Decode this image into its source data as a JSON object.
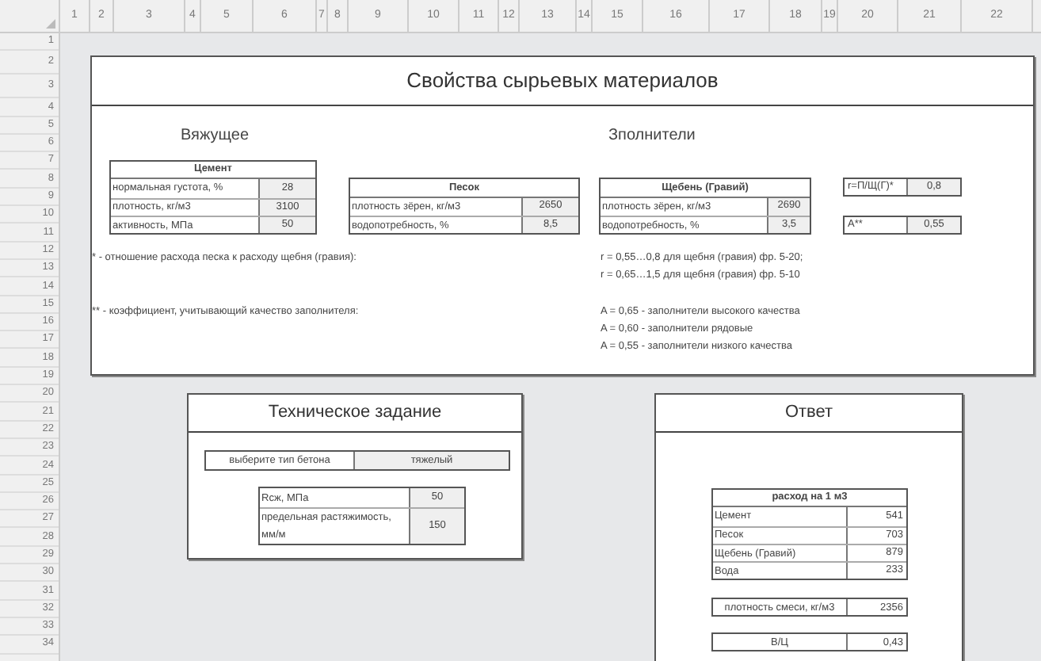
{
  "sheet": {
    "columns": [
      "1",
      "2",
      "3",
      "4",
      "5",
      "6",
      "7",
      "8",
      "9",
      "10",
      "11",
      "12",
      "13",
      "14",
      "15",
      "16",
      "17",
      "18",
      "19",
      "20",
      "21",
      "22"
    ],
    "rows": [
      "1",
      "2",
      "3",
      "4",
      "5",
      "6",
      "7",
      "8",
      "9",
      "10",
      "11",
      "12",
      "13",
      "14",
      "15",
      "16",
      "17",
      "18",
      "19",
      "20",
      "21",
      "22",
      "23",
      "24",
      "25",
      "26",
      "27",
      "28",
      "29",
      "30",
      "31",
      "32",
      "33",
      "34"
    ]
  },
  "properties": {
    "title": "Свойства сырьевых материалов",
    "binder": {
      "heading": "Вяжущее",
      "table": {
        "title": "Цемент",
        "rows": [
          {
            "label": "нормальная густота, %",
            "value": "28"
          },
          {
            "label": "плотность, кг/м3",
            "value": "3100"
          },
          {
            "label": "активность, МПа",
            "value": "50"
          }
        ]
      }
    },
    "aggregates": {
      "heading": "Зполнители",
      "sand": {
        "title": "Песок",
        "rows": [
          {
            "label": "плотность зёрен, кг/м3",
            "value": "2650"
          },
          {
            "label": "водопотребность, %",
            "value": "8,5"
          }
        ]
      },
      "gravel": {
        "title": "Щебень (Гравий)",
        "rows": [
          {
            "label": "плотность зёрен, кг/м3",
            "value": "2690"
          },
          {
            "label": "водопотребность, %",
            "value": "3,5"
          }
        ]
      },
      "ratio": {
        "label": "r=П/Щ(Г)*",
        "value": "0,8"
      },
      "quality": {
        "label": "A**",
        "value": "0,55"
      }
    },
    "notes": [
      {
        "left": "* - отношение расхода песка к расходу щебня (гравия):",
        "right": [
          "r = 0,55…0,8 для щебня (гравия) фр. 5-20;",
          "r = 0,65…1,5 для щебня (гравия) фр. 5-10"
        ]
      },
      {
        "left": "** - коэффициент, учитывающий качество заполнителя:",
        "right": [
          "A = 0,65 - заполнители высокого качества",
          "A = 0,60 - заполнители рядовые",
          "A = 0,55 - заполнители низкого качества"
        ]
      }
    ]
  },
  "task": {
    "title": "Техническое задание",
    "concrete_type": {
      "label": "выберите тип бетона",
      "value": "тяжелый"
    },
    "rows": [
      {
        "label": "Rсж, МПа",
        "value": "50"
      },
      {
        "label": "предельная растяжимость, мм/м",
        "value": "150"
      }
    ]
  },
  "answer": {
    "title": "Ответ",
    "table": {
      "title": "расход на 1 м3",
      "rows": [
        {
          "label": "Цемент",
          "value": "541"
        },
        {
          "label": "Песок",
          "value": "703"
        },
        {
          "label": "Щебень (Гравий)",
          "value": "879"
        },
        {
          "label": "Вода",
          "value": "233"
        }
      ]
    },
    "density": {
      "label": "плотность смеси, кг/м3",
      "value": "2356"
    },
    "wc": {
      "label": "В/Ц",
      "value": "0,43"
    }
  }
}
